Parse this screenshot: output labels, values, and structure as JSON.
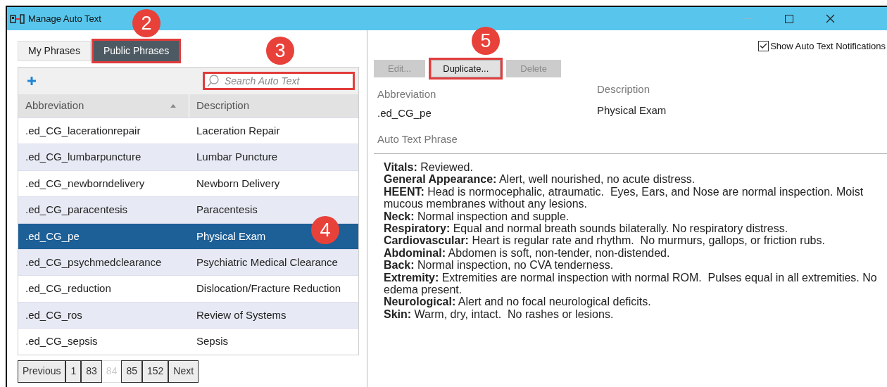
{
  "window": {
    "title": "Manage Auto Text"
  },
  "tabs": [
    {
      "label": "My Phrases",
      "selected": false,
      "highlighted": false
    },
    {
      "label": "Public Phrases",
      "selected": true,
      "highlighted": true
    }
  ],
  "search": {
    "placeholder": "Search Auto Text",
    "highlighted": true
  },
  "table": {
    "columns": [
      {
        "label": "Abbreviation",
        "sorted": true
      },
      {
        "label": "Description",
        "sorted": false
      }
    ],
    "rows": [
      {
        "abbreviation": ".ed_CG_lacerationrepair",
        "description": "Laceration Repair",
        "selected": false
      },
      {
        "abbreviation": ".ed_CG_lumbarpuncture",
        "description": "Lumbar Puncture",
        "selected": false
      },
      {
        "abbreviation": ".ed_CG_newborndelivery",
        "description": "Newborn Delivery",
        "selected": false
      },
      {
        "abbreviation": ".ed_CG_paracentesis",
        "description": "Paracentesis",
        "selected": false
      },
      {
        "abbreviation": ".ed_CG_pe",
        "description": "Physical Exam",
        "selected": true
      },
      {
        "abbreviation": ".ed_CG_psychmedclearance",
        "description": "Psychiatric Medical Clearance",
        "selected": false
      },
      {
        "abbreviation": ".ed_CG_reduction",
        "description": "Dislocation/Fracture Reduction",
        "selected": false
      },
      {
        "abbreviation": ".ed_CG_ros",
        "description": "Review of Systems",
        "selected": false
      },
      {
        "abbreviation": ".ed_CG_sepsis",
        "description": "Sepsis",
        "selected": false
      }
    ]
  },
  "pagination": [
    {
      "label": "Previous",
      "selected": false
    },
    {
      "label": "1",
      "selected": false
    },
    {
      "label": "83",
      "selected": false
    },
    {
      "label": "84",
      "selected": true
    },
    {
      "label": "85",
      "selected": false
    },
    {
      "label": "152",
      "selected": false
    },
    {
      "label": "Next",
      "selected": false
    }
  ],
  "notifications": {
    "label": "Show Auto Text Notifications",
    "checked": true
  },
  "actions": [
    {
      "label": "Edit...",
      "disabled": true,
      "highlighted": false
    },
    {
      "label": "Duplicate...",
      "disabled": false,
      "highlighted": true
    },
    {
      "label": "Delete",
      "disabled": true,
      "highlighted": false
    }
  ],
  "details": {
    "abbreviation_label": "Abbreviation",
    "abbreviation": ".ed_CG_pe",
    "description_label": "Description",
    "description": "Physical Exam",
    "phrase_label": "Auto Text Phrase"
  },
  "phrase": [
    "**Vitals:** Reviewed.",
    "**General Appearance:** Alert, well nourished, no acute distress.",
    "**HEENT:** Head is normocephalic, atraumatic.  Eyes, Ears, and Nose are normal inspection. Moist mucous membranes without any lesions.",
    "**Neck:** Normal inspection and supple.",
    "**Respiratory:** Equal and normal breath sounds bilaterally. No respiratory distress.",
    "**Cardiovascular:** Heart is regular rate and rhythm.  No murmurs, gallops, or friction rubs.",
    "**Abdominal:** Abdomen is soft, non-tender, non-distended.",
    "**Back:** Normal inspection, no CVA tenderness.",
    "**Extremity:** Extremities are normal inspection with normal ROM.  Pulses equal in all extremities. No edema present.",
    "**Neurological:** Alert and no focal neurological deficits.",
    "**Skin:** Warm, dry, intact.  No rashes or lesions."
  ],
  "callouts": [
    {
      "label": "2"
    },
    {
      "label": "3"
    },
    {
      "label": "4"
    },
    {
      "label": "5"
    }
  ]
}
